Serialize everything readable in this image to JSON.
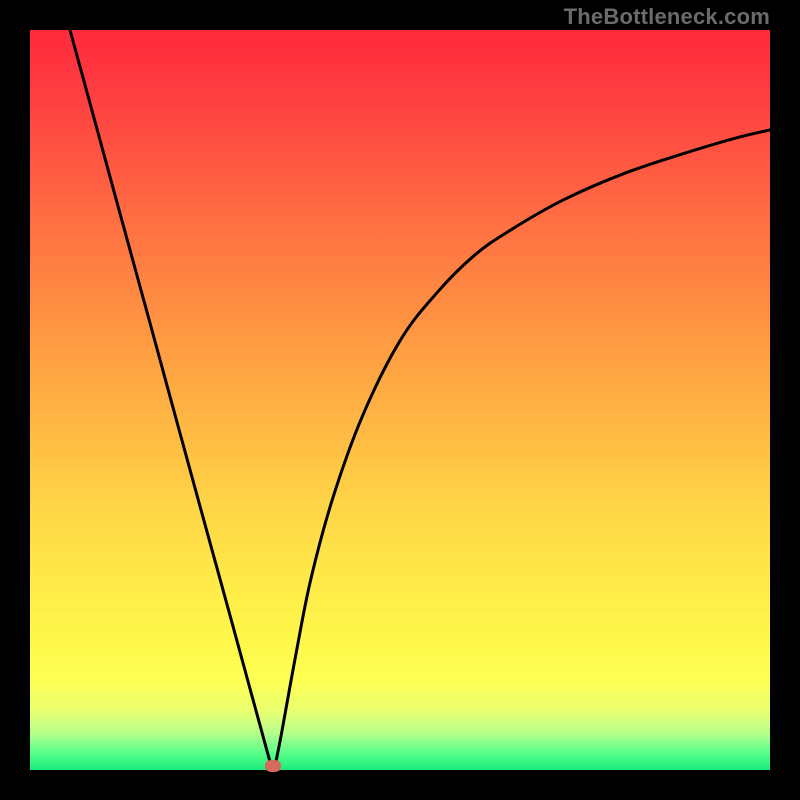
{
  "watermark": "TheBottleneck.com",
  "colors": {
    "background": "#000000",
    "curve": "#000000",
    "marker": "#d56a5c"
  },
  "chart_data": {
    "type": "line",
    "title": "",
    "xlabel": "",
    "ylabel": "",
    "xlim": [
      0,
      100
    ],
    "ylim": [
      0,
      100
    ],
    "grid": false,
    "legend": false,
    "series": [
      {
        "name": "left-branch",
        "x": [
          5.4,
          8,
          12,
          16,
          20,
          24,
          27,
          30,
          32.6
        ],
        "y": [
          100,
          90.5,
          75.8,
          61.2,
          46.5,
          31.9,
          21,
          10,
          0.5
        ]
      },
      {
        "name": "right-branch",
        "x": [
          33.1,
          34,
          36,
          38,
          41,
          45,
          50,
          55,
          60,
          65,
          72,
          80,
          88,
          95,
          100
        ],
        "y": [
          0.5,
          5,
          16,
          26,
          37,
          48,
          58,
          64.5,
          69.5,
          73,
          77,
          80.5,
          83.2,
          85.3,
          86.5
        ]
      }
    ],
    "marker": {
      "x": 32.9,
      "y": 0.5
    },
    "gradient_stops": [
      {
        "pct": 0,
        "color": "#ff2a3a"
      },
      {
        "pct": 50,
        "color": "#ffbe44"
      },
      {
        "pct": 90,
        "color": "#fdff54"
      },
      {
        "pct": 100,
        "color": "#18ec7c"
      }
    ],
    "notes": "V-shaped bottleneck curve over a red→green vertical gradient. Values are estimates read from an untitled twin-curve plot; y=0 at bottom, x=0 at left."
  }
}
